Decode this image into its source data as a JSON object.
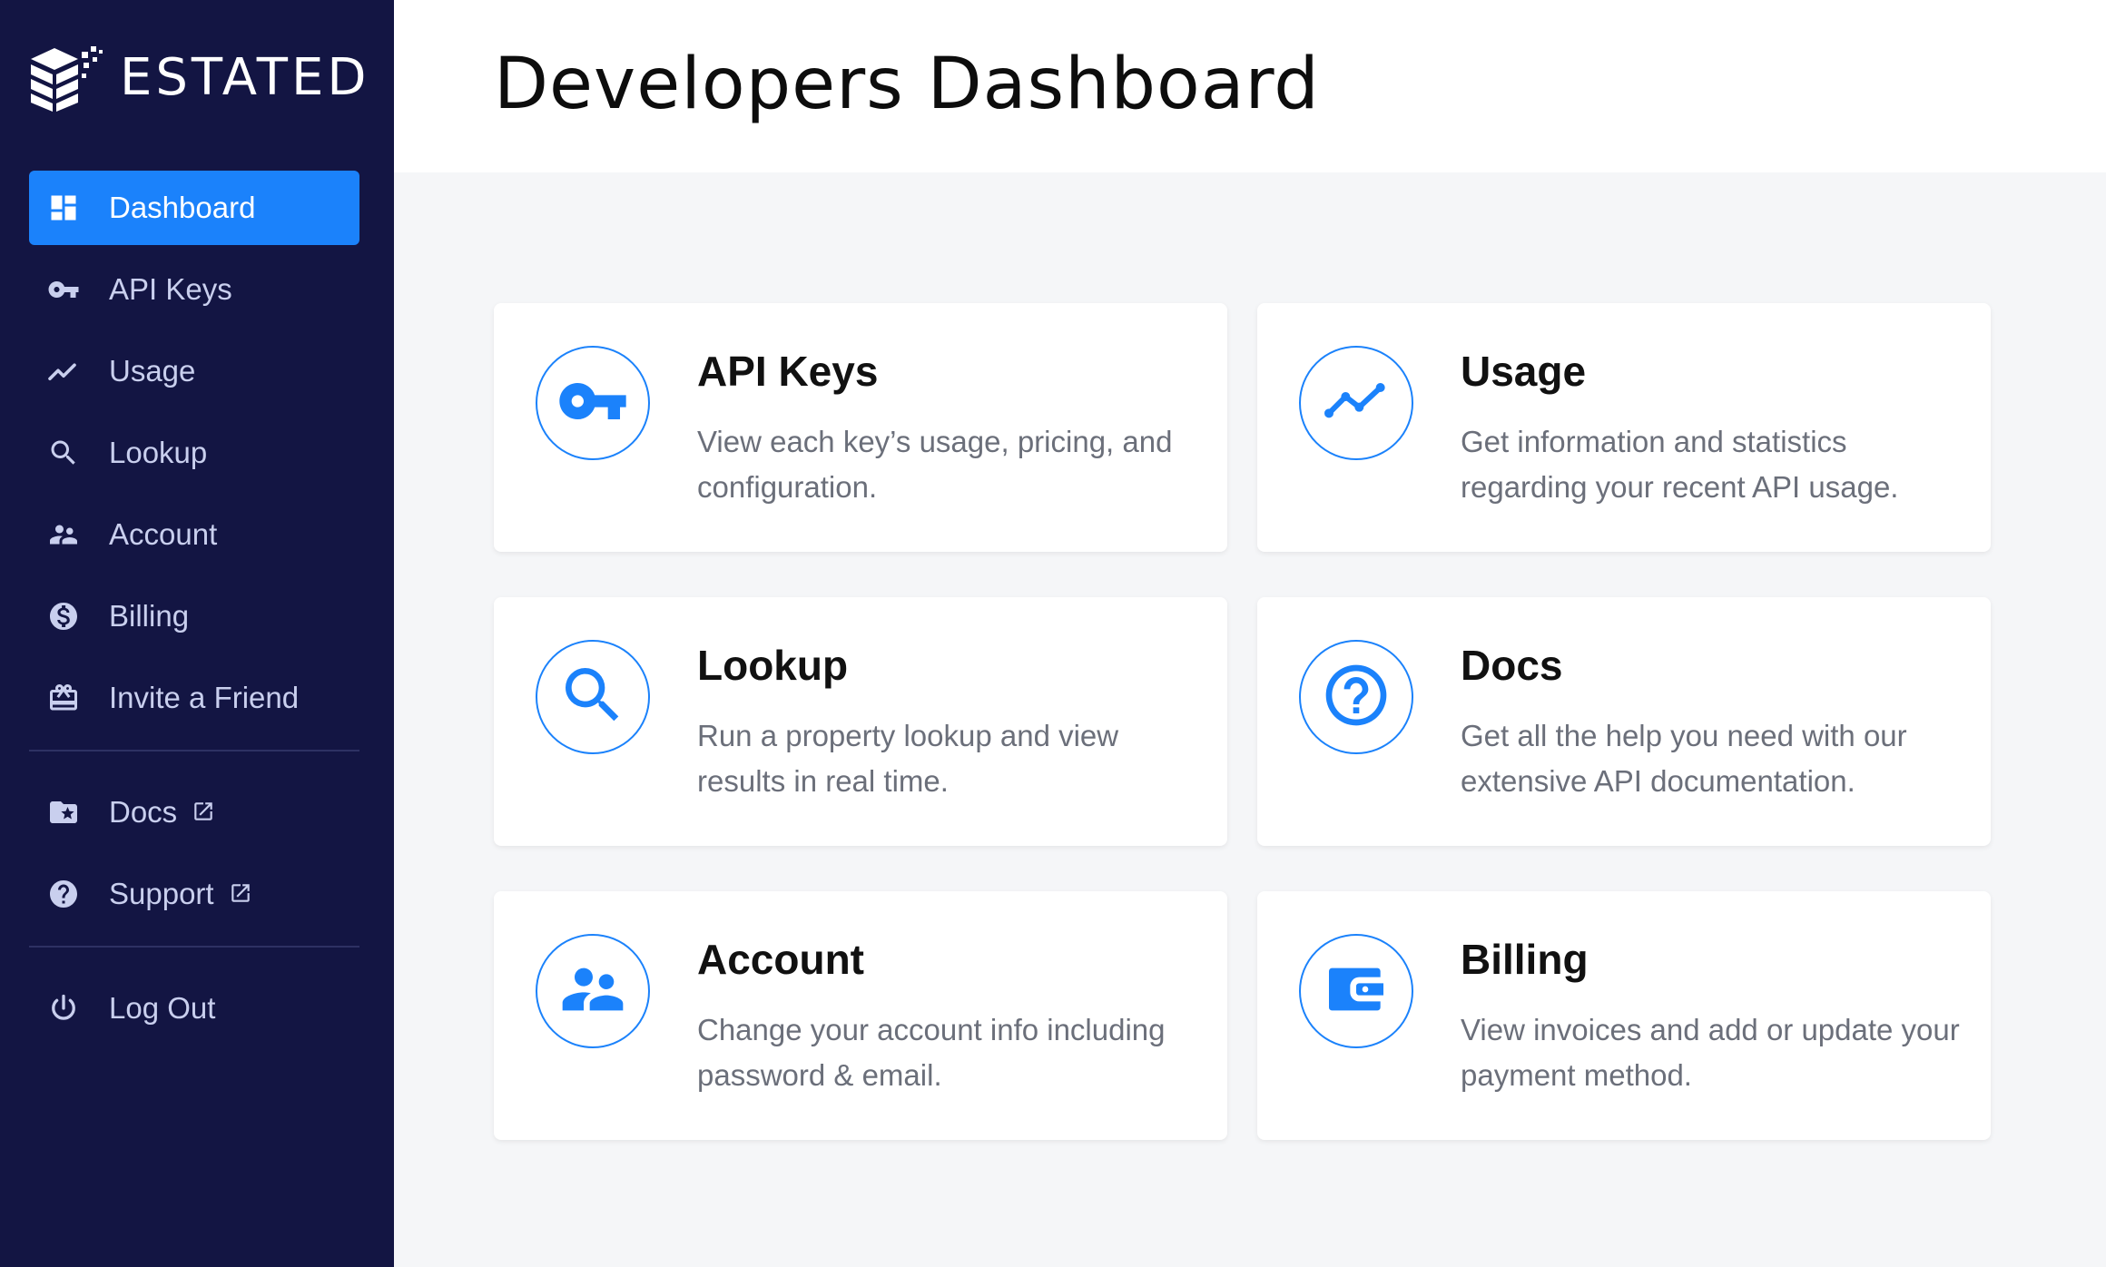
{
  "brand": {
    "name": "ESTATED"
  },
  "sidebar": {
    "items": [
      {
        "label": "Dashboard",
        "icon": "dashboard-icon",
        "active": true
      },
      {
        "label": "API Keys",
        "icon": "key-icon"
      },
      {
        "label": "Usage",
        "icon": "trend-icon"
      },
      {
        "label": "Lookup",
        "icon": "search-icon"
      },
      {
        "label": "Account",
        "icon": "people-icon"
      },
      {
        "label": "Billing",
        "icon": "dollar-icon"
      },
      {
        "label": "Invite a Friend",
        "icon": "gift-icon"
      }
    ],
    "external": [
      {
        "label": "Docs",
        "icon": "folder-star-icon"
      },
      {
        "label": "Support",
        "icon": "help-circle-icon"
      }
    ],
    "logout": {
      "label": "Log Out",
      "icon": "power-icon"
    }
  },
  "header": {
    "title": "Developers Dashboard"
  },
  "cards": [
    {
      "title": "API Keys",
      "desc": "View each key’s usage, pricing, and configuration.",
      "icon": "key-icon"
    },
    {
      "title": "Usage",
      "desc": "Get information and statistics regarding your recent API usage.",
      "icon": "trend-icon"
    },
    {
      "title": "Lookup",
      "desc": "Run a property lookup and view results in real time.",
      "icon": "search-icon"
    },
    {
      "title": "Docs",
      "desc": "Get all the help you need with our extensive API documentation.",
      "icon": "help-icon"
    },
    {
      "title": "Account",
      "desc": "Change your account info including password & email.",
      "icon": "people-icon"
    },
    {
      "title": "Billing",
      "desc": "View invoices and add or update your payment method.",
      "icon": "wallet-icon"
    }
  ],
  "colors": {
    "sidebar_bg": "#131543",
    "accent": "#1b82fb",
    "page_bg": "#f5f6f8"
  }
}
